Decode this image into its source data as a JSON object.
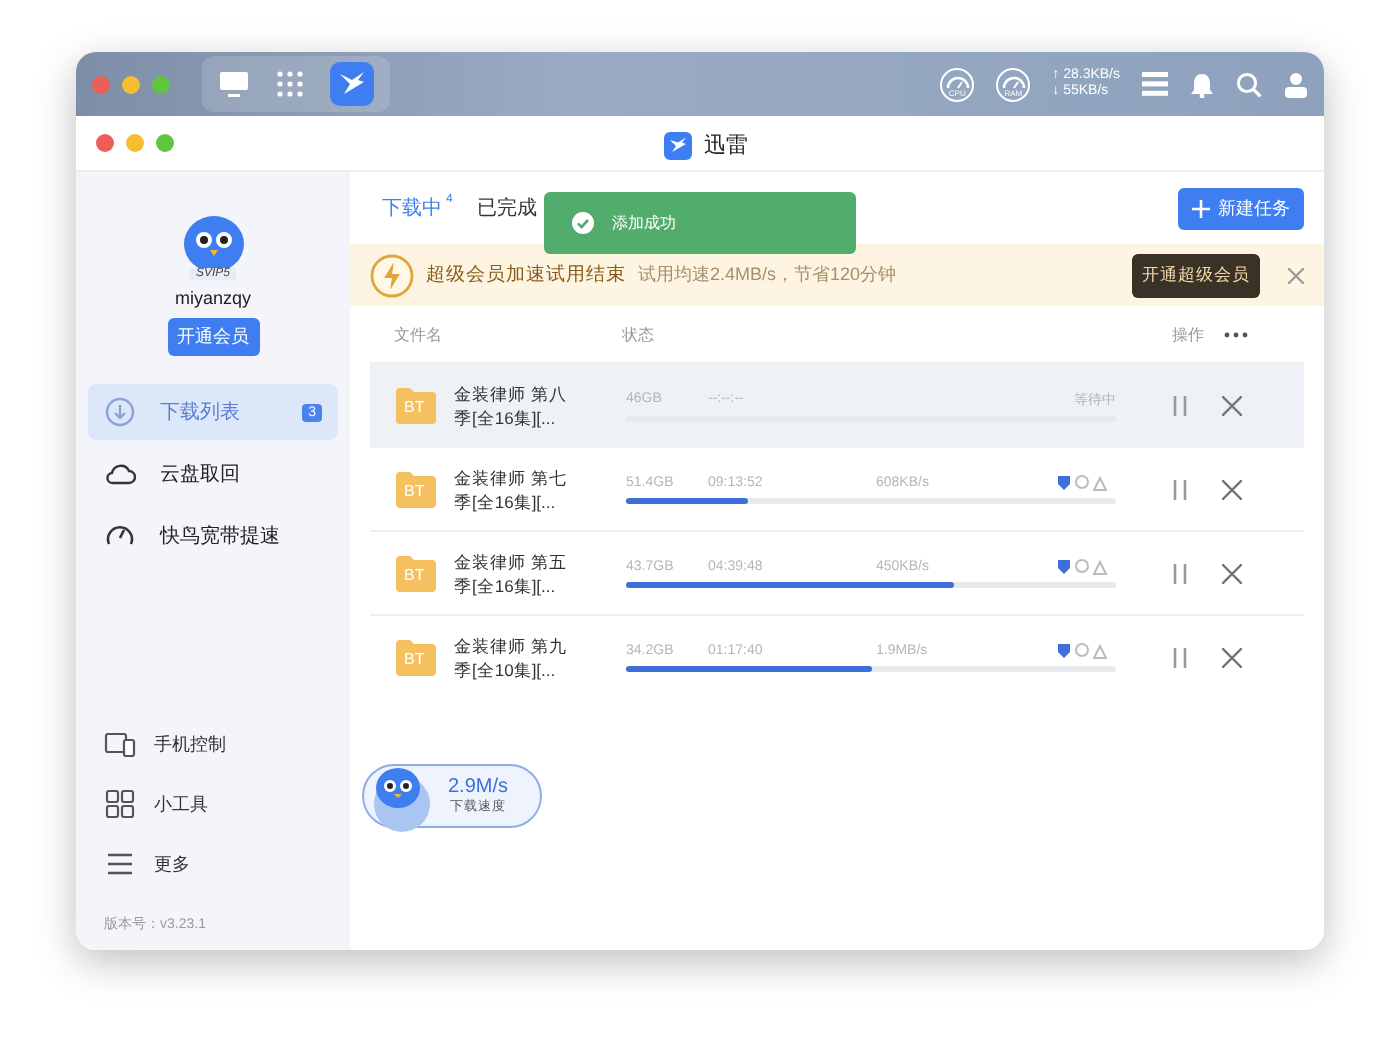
{
  "desktop_bar": {
    "tray": {
      "cpu_label": "CPU",
      "ram_label": "RAM",
      "upload": "↑ 28.3KB/s",
      "download": "↓ 55KB/s"
    }
  },
  "window": {
    "title": "迅雷"
  },
  "sidebar": {
    "user": {
      "badge": "SVIP5",
      "name": "miyanzqy",
      "button": "开通会员"
    },
    "items": [
      {
        "kind": "download",
        "label": "下载列表",
        "badge": "3",
        "selected": true
      },
      {
        "kind": "cloud",
        "label": "云盘取回",
        "selected": false
      },
      {
        "kind": "speed",
        "label": "快鸟宽带提速",
        "selected": false
      }
    ],
    "bottom_items": [
      {
        "kind": "phone",
        "label": "手机控制"
      },
      {
        "kind": "tools",
        "label": "小工具"
      },
      {
        "kind": "more",
        "label": "更多"
      }
    ],
    "version": "版本号：v3.23.1"
  },
  "tabs": [
    {
      "label": "下载中",
      "count": "4",
      "selected": true
    },
    {
      "label": "已完成",
      "selected": false
    }
  ],
  "toast": {
    "text": "添加成功"
  },
  "new_task_button": "新建任务",
  "promo": {
    "title": "超级会员加速试用结束",
    "text": "试用均速2.4MB/s，节省120分钟",
    "button": "开通超级会员"
  },
  "table": {
    "columns": [
      "文件名",
      "状态",
      "操作"
    ],
    "rows": [
      {
        "type_label": "BT",
        "name": "金装律师 第八季[全16集][...",
        "size": "46GB",
        "time": "--:--:--",
        "status": "等待中",
        "selected": true
      },
      {
        "type_label": "BT",
        "name": "金装律师 第七季[全16集][...",
        "size": "51.4GB",
        "time": "09:13:52",
        "speed": "608KB/s",
        "level": 0.25,
        "selected": false
      },
      {
        "type_label": "BT",
        "name": "金装律师 第五季[全16集][...",
        "size": "43.7GB",
        "time": "04:39:48",
        "speed": "450KB/s",
        "level": 0.67,
        "selected": false
      },
      {
        "type_label": "BT",
        "name": "金装律师 第九季[全10集][...",
        "size": "34.2GB",
        "time": "01:17:40",
        "speed": "1.9MB/s",
        "level": 0.5,
        "selected": false
      }
    ]
  },
  "speed_widget": {
    "value": "2.9M/s",
    "label": "下载速度"
  }
}
